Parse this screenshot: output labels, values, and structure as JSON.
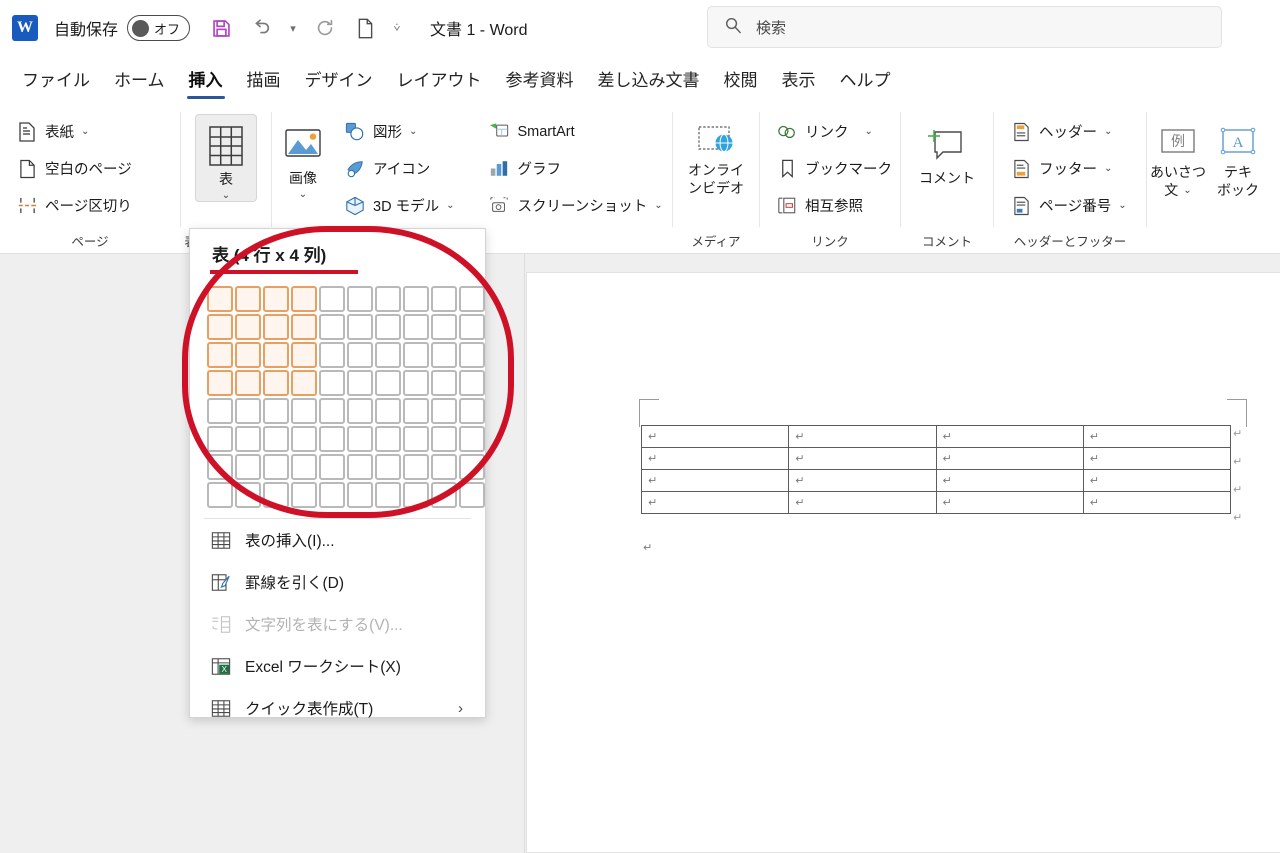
{
  "titlebar": {
    "app_logo": "word-logo",
    "logo_letter": "W",
    "autosave_label": "自動保存",
    "autosave_state": "オフ",
    "save_icon": "save-icon",
    "undo_icon": "undo-icon",
    "redo_icon": "redo-icon",
    "newdoc_icon": "new-document-icon",
    "more_icon": "customize-quick-access-icon",
    "document_title": "文書 1  -  Word"
  },
  "search": {
    "icon": "search-icon",
    "placeholder": "検索"
  },
  "tabs": [
    {
      "label": "ファイル",
      "active": false
    },
    {
      "label": "ホーム",
      "active": false
    },
    {
      "label": "挿入",
      "active": true
    },
    {
      "label": "描画",
      "active": false
    },
    {
      "label": "デザイン",
      "active": false
    },
    {
      "label": "レイアウト",
      "active": false
    },
    {
      "label": "参考資料",
      "active": false
    },
    {
      "label": "差し込み文書",
      "active": false
    },
    {
      "label": "校閲",
      "active": false
    },
    {
      "label": "表示",
      "active": false
    },
    {
      "label": "ヘルプ",
      "active": false
    }
  ],
  "ribbon": {
    "groups": [
      {
        "name": "pages",
        "label": "ページ",
        "items": [
          {
            "label": "表紙",
            "icon": "cover-page-icon",
            "has_chevron": true
          },
          {
            "label": "空白のページ",
            "icon": "blank-page-icon",
            "has_chevron": false
          },
          {
            "label": "ページ区切り",
            "icon": "page-break-icon",
            "has_chevron": false
          }
        ]
      },
      {
        "name": "tables",
        "label": "表 (4 行 x 4 列)",
        "big_button": {
          "label": "表",
          "icon": "table-icon",
          "pressed": true,
          "has_chevron": true
        }
      },
      {
        "name": "illustrations",
        "label": "",
        "big_button": {
          "label": "画像",
          "icon": "pictures-icon",
          "pressed": false,
          "has_chevron": true
        },
        "items": [
          {
            "label": "図形",
            "icon": "shapes-icon",
            "has_chevron": true
          },
          {
            "label": "アイコン",
            "icon": "icons-icon",
            "has_chevron": false
          },
          {
            "label": "3D モデル",
            "icon": "3d-model-icon",
            "has_chevron": true
          },
          {
            "label": "SmartArt",
            "icon": "smartart-icon",
            "has_chevron": false
          },
          {
            "label": "グラフ",
            "icon": "chart-icon",
            "has_chevron": false
          },
          {
            "label": "スクリーンショット",
            "icon": "screenshot-icon",
            "has_chevron": true
          }
        ]
      },
      {
        "name": "media",
        "label": "メディア",
        "big_button": {
          "label": "オンライン\nビデオ",
          "label_line1": "オンライ",
          "label_line2": "ンビデオ",
          "icon": "online-video-icon",
          "pressed": false,
          "has_chevron": false
        }
      },
      {
        "name": "links",
        "label": "リンク",
        "items": [
          {
            "label": "リンク",
            "icon": "link-icon",
            "has_chevron": true
          },
          {
            "label": "ブックマーク",
            "icon": "bookmark-icon",
            "has_chevron": false
          },
          {
            "label": "相互参照",
            "icon": "cross-reference-icon",
            "has_chevron": false
          }
        ]
      },
      {
        "name": "comments",
        "label": "コメント",
        "big_button": {
          "label": "コメント",
          "icon": "new-comment-icon",
          "pressed": false,
          "has_chevron": false
        }
      },
      {
        "name": "header-footer",
        "label": "ヘッダーとフッター",
        "items": [
          {
            "label": "ヘッダー",
            "icon": "header-icon",
            "has_chevron": true
          },
          {
            "label": "フッター",
            "icon": "footer-icon",
            "has_chevron": true
          },
          {
            "label": "ページ番号",
            "icon": "page-number-icon",
            "has_chevron": true
          }
        ]
      },
      {
        "name": "text",
        "label": "",
        "big_buttons": [
          {
            "label_line1": "あいさつ",
            "label_line2": "文",
            "icon": "greeting-text-icon",
            "sample_char": "例",
            "has_chevron": true
          },
          {
            "label_line1": "テキ",
            "label_line2": "ボック",
            "icon": "text-box-icon",
            "sample_char": "A",
            "has_chevron": false
          }
        ]
      }
    ]
  },
  "table_menu": {
    "title": "表 (4 行 x 4 列)",
    "grid": {
      "columns": 10,
      "rows": 8,
      "selected_columns": 4,
      "selected_rows": 4,
      "selected_color": "#E8A062",
      "unselected_color": "#b9b9b9"
    },
    "items": [
      {
        "label": "表の挿入(I)...",
        "icon": "insert-table-icon",
        "disabled": false,
        "has_submenu": false
      },
      {
        "label": "罫線を引く(D)",
        "icon": "draw-table-icon",
        "disabled": false,
        "has_submenu": false
      },
      {
        "label": "文字列を表にする(V)...",
        "icon": "convert-text-to-table-icon",
        "disabled": true,
        "has_submenu": false
      },
      {
        "label": "Excel ワークシート(X)",
        "icon": "excel-spreadsheet-icon",
        "disabled": false,
        "has_submenu": false
      },
      {
        "label": "クイック表作成(T)",
        "icon": "quick-tables-icon",
        "disabled": false,
        "has_submenu": true,
        "arrow": "›"
      }
    ]
  },
  "document": {
    "table": {
      "rows": 4,
      "columns": 4,
      "cell_mark": "↵",
      "row_end_mark": "↵"
    },
    "paragraph_mark": "↵"
  },
  "annotation": {
    "type": "red-ellipse-highlight",
    "color": "#CE1126"
  }
}
